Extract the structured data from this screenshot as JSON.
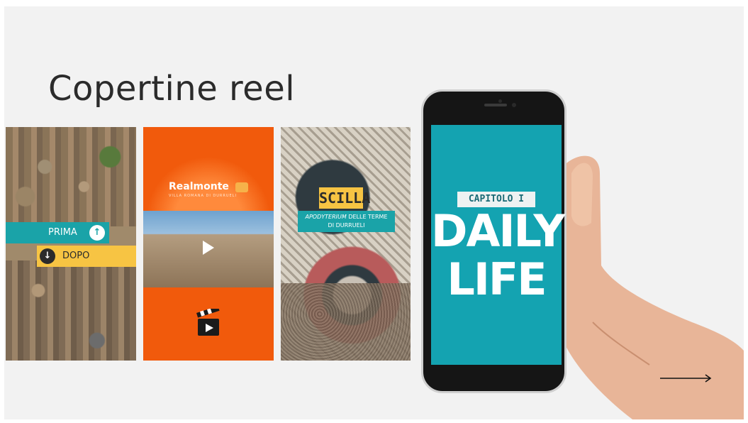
{
  "slide": {
    "title": "Copertine reel"
  },
  "card_before_after": {
    "prima_label": "PRIMA",
    "prima_icon": "arrow-up-icon",
    "dopo_label": "DOPO",
    "dopo_icon": "arrow-down-icon",
    "teal_color": "#1aa3a8",
    "yellow_color": "#f7c443"
  },
  "card_realmonte": {
    "brand": "Realmonte",
    "brand_sub": "VILLA ROMANA DI DURRUELI",
    "play_icon": "play-icon",
    "clapper_icon": "clapperboard-icon",
    "orange_color": "#f15a0c"
  },
  "card_scilla": {
    "title": "SCILLA",
    "subtitle_italic": "APODYTERIUM",
    "subtitle_rest": "DELLE TERME",
    "subtitle_line2": "DI DURRUELI"
  },
  "phone_screen": {
    "chapter": "CAPITOLO I",
    "line1": "DAILY",
    "line2": "LIFE",
    "screen_color": "#14a3b1"
  },
  "navigation": {
    "next_icon": "arrow-right-icon"
  }
}
